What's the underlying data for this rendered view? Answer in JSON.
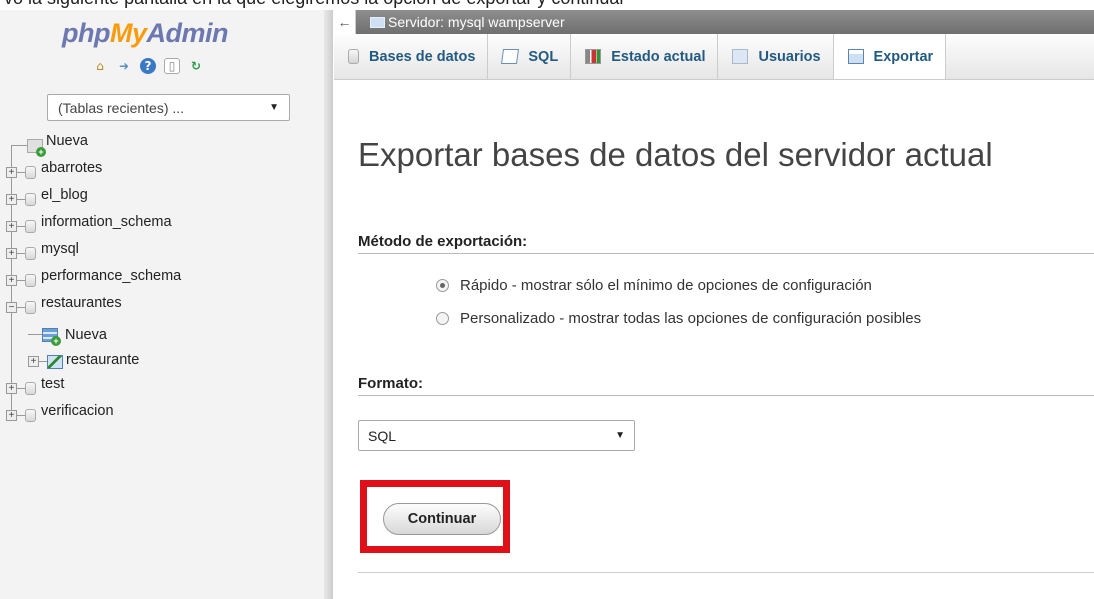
{
  "top_caption": "vo la siguiente pantalla en la que elegiremos la opción de exportar y continuar",
  "nav": {
    "logo_php": "php",
    "logo_my": "My",
    "logo_admin": "Admin",
    "recent_tables": "(Tablas recientes) ...",
    "tree": [
      {
        "label": "Nueva",
        "type": "new"
      },
      {
        "label": "abarrotes",
        "type": "db"
      },
      {
        "label": "el_blog",
        "type": "db"
      },
      {
        "label": "information_schema",
        "type": "db"
      },
      {
        "label": "mysql",
        "type": "db"
      },
      {
        "label": "performance_schema",
        "type": "db"
      },
      {
        "label": "restaurantes",
        "type": "db-open"
      },
      {
        "label": "Nueva",
        "type": "new-table"
      },
      {
        "label": "restaurante",
        "type": "table"
      },
      {
        "label": "test",
        "type": "db"
      },
      {
        "label": "verificacion",
        "type": "db"
      }
    ]
  },
  "breadcrumb": {
    "back": "←",
    "server": "Servidor: mysql wampserver"
  },
  "tabs": [
    {
      "label": "Bases de datos",
      "icon": "database-icon"
    },
    {
      "label": "SQL",
      "icon": "sql-icon"
    },
    {
      "label": "Estado actual",
      "icon": "status-icon"
    },
    {
      "label": "Usuarios",
      "icon": "users-icon"
    },
    {
      "label": "Exportar",
      "icon": "export-icon",
      "active": true
    }
  ],
  "main": {
    "title": "Exportar bases de datos del servidor actual",
    "method_title": "Método de exportación:",
    "method_options": [
      {
        "label": "Rápido - mostrar sólo el mínimo de opciones de configuración",
        "checked": true
      },
      {
        "label": "Personalizado - mostrar todas las opciones de configuración posibles",
        "checked": false
      }
    ],
    "format_title": "Formato:",
    "format_value": "SQL",
    "continue_label": "Continuar"
  },
  "colors": {
    "highlight": "#e0101a",
    "link": "#235a81",
    "logo_blue": "#6c78af",
    "logo_orange": "#f89c0e"
  }
}
